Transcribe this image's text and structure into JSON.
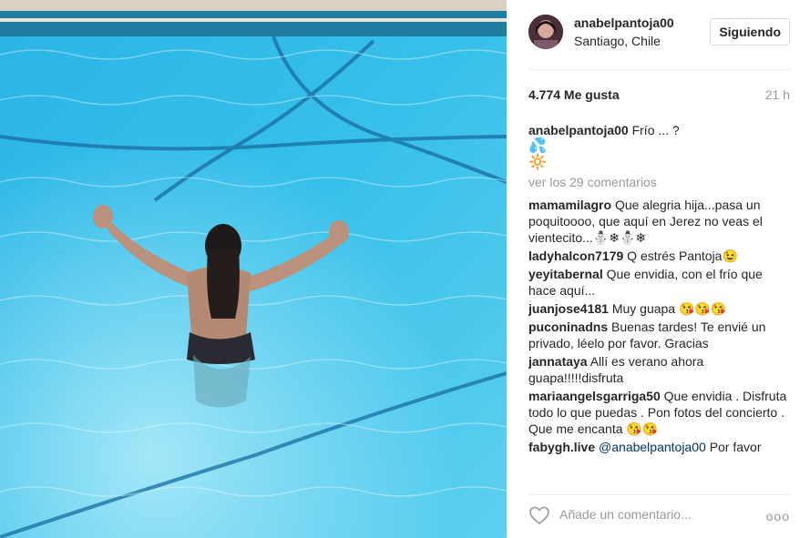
{
  "post": {
    "username": "anabelpantoja00",
    "location": "Santiago, Chile",
    "follow_label": "Siguiendo",
    "likes": "4.774 Me gusta",
    "time": "21 h",
    "caption_user": "anabelpantoja00",
    "caption_text": "Frío ... ?",
    "caption_emoji_1": "💦",
    "caption_emoji_2": "🔆",
    "view_all": "ver los 29 comentarios"
  },
  "comments": [
    {
      "user": "mamamilagro",
      "text": "Que alegria hija...pasa un poquitoooo, que aquí en Jerez no veas el vientecito...⛄❄⛄❄"
    },
    {
      "user": "ladyhalcon7179",
      "text": "Q estrés Pantoja😉"
    },
    {
      "user": "yeyitabernal",
      "text": "Que envidia, con el frío que hace aquí..."
    },
    {
      "user": "juanjose4181",
      "text": "Muy guapa 😘😘😘"
    },
    {
      "user": "puconinadns",
      "text": "Buenas tardes! Te envié un privado, léelo por favor. Gracias"
    },
    {
      "user": "jannataya",
      "text": "Allí es verano ahora guapa!!!!!disfruta"
    },
    {
      "user": "mariaangelsgarriga50",
      "text": "Que envidia . Disfruta todo lo que puedas . Pon fotos del concierto . Que me encanta 😘😘"
    },
    {
      "user": "fabygh.live",
      "mention": "@anabelpantoja00",
      "text": "Por favor"
    }
  ],
  "add_comment": {
    "placeholder": "Añade un comentario...",
    "more_label": "ooo"
  }
}
